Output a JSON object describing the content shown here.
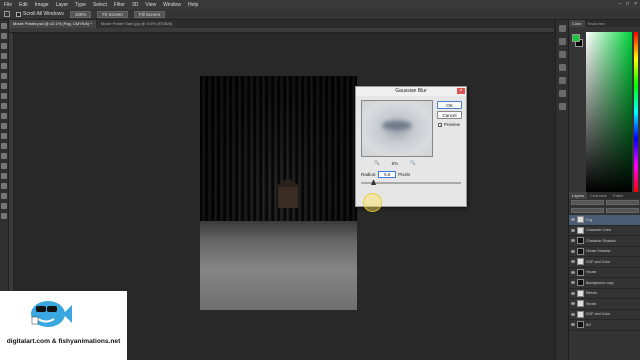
{
  "menubar": {
    "items": [
      "File",
      "Edit",
      "Image",
      "Layer",
      "Type",
      "Select",
      "Filter",
      "3D",
      "View",
      "Window",
      "Help"
    ],
    "window_controls": [
      "–",
      "□",
      "×"
    ]
  },
  "options_bar": {
    "scroll_all_windows": "Scroll All Windows",
    "btn_100": "100%",
    "btn_fit": "Fit Screen",
    "btn_fill": "Fill Screen"
  },
  "tabs": [
    "Movie Poster.psd @ 42.1% (Fog, CMYK/8) *",
    "Movie Poster Sam.jpg @ 100% (RGB/8)"
  ],
  "dialog": {
    "title": "Gaussian Blur",
    "ok": "OK",
    "cancel": "Cancel",
    "preview_label": "Preview",
    "preview_checked": "✓",
    "zoom_in": "🔍",
    "zoom_level": "8%",
    "zoom_out": "🔍",
    "radius_label": "Radius:",
    "radius_value": "5.6",
    "units": "Pixels"
  },
  "panels": {
    "top_tabs": [
      "Color",
      "Swatches"
    ],
    "fg_color": "#19c93b",
    "bg_color": "#000000",
    "layer_tabs": [
      "Layers",
      "Channels",
      "Paths"
    ],
    "layers": [
      {
        "name": "Fog",
        "selected": true,
        "dark": false
      },
      {
        "name": "Character Color",
        "selected": false,
        "dark": false
      },
      {
        "name": "Character Shadow",
        "selected": false,
        "dark": true
      },
      {
        "name": "House Shadow",
        "selected": false,
        "dark": true
      },
      {
        "name": "DOF and Color",
        "selected": false,
        "dark": false
      },
      {
        "name": "House",
        "selected": false,
        "dark": true
      },
      {
        "name": "Background copy",
        "selected": false,
        "dark": true
      },
      {
        "name": "Effects",
        "selected": false,
        "dark": false
      },
      {
        "name": "Stroke",
        "selected": false,
        "dark": false
      },
      {
        "name": "DOF and Color",
        "selected": false,
        "dark": false
      },
      {
        "name": "BG",
        "selected": false,
        "dark": true
      }
    ]
  },
  "watermark": {
    "text": "digitalart.com & fishyanimations.net"
  }
}
